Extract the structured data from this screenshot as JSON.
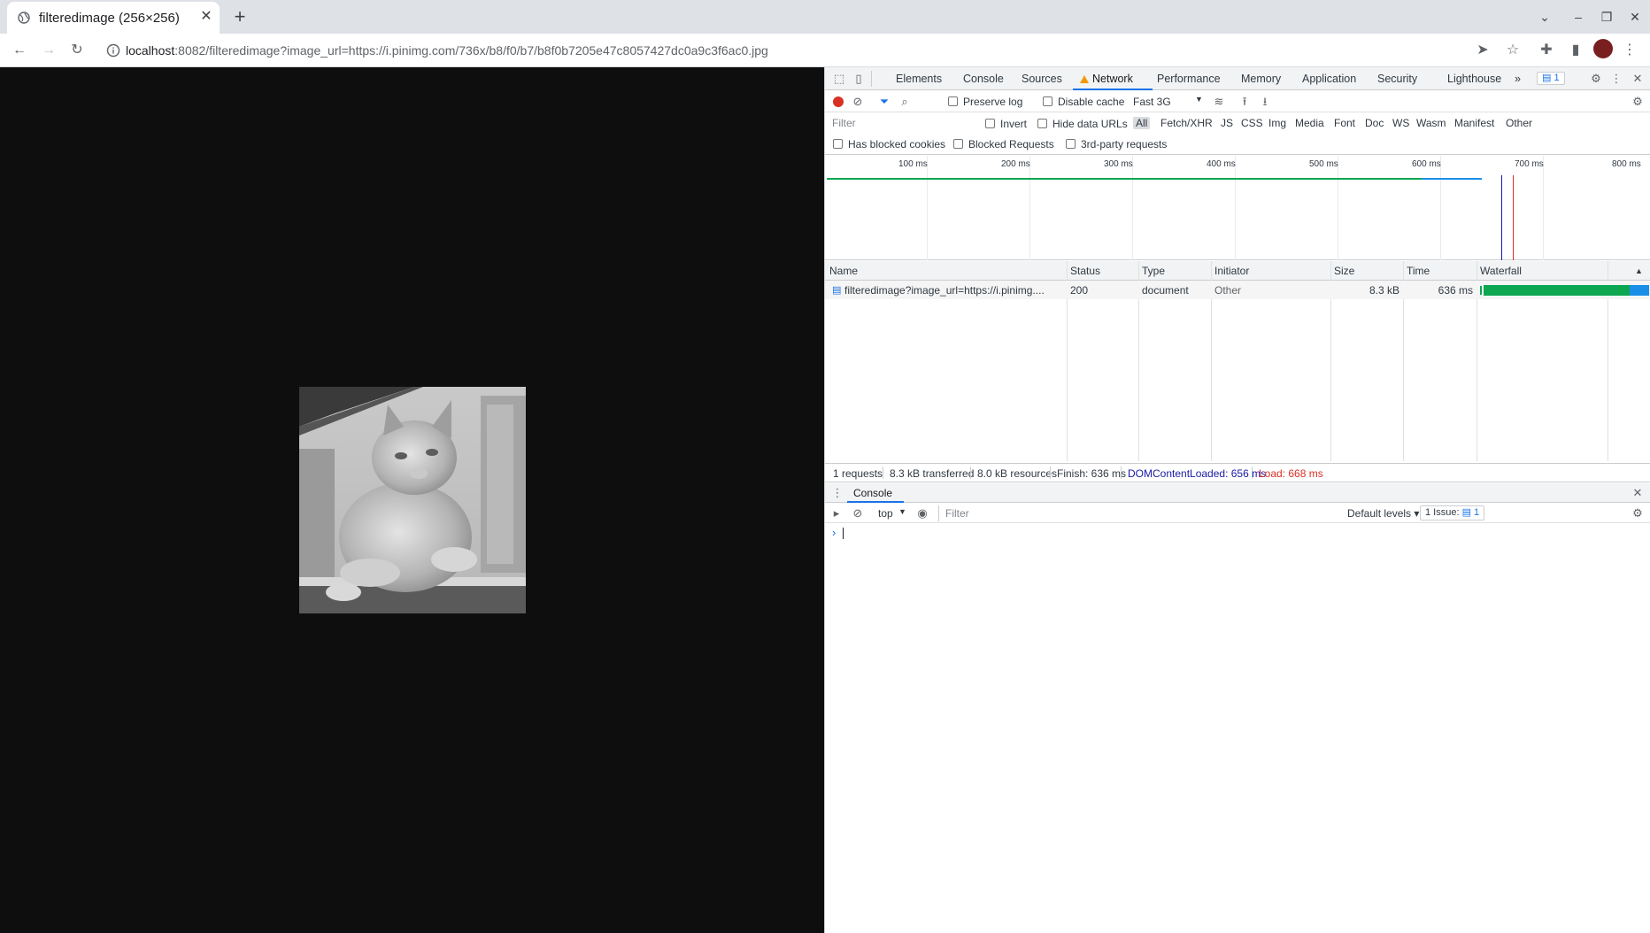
{
  "browser": {
    "tab": {
      "title": "filteredimage (256×256)",
      "close_label": "✕"
    },
    "new_tab_label": "+",
    "url": {
      "host": "localhost",
      "rest": ":8082/filteredimage?image_url=https://i.pinimg.com/736x/b8/f0/b7/b8f0b7205e47c8057427dc0a9c3f6ac0.jpg"
    }
  },
  "devtools": {
    "tabs": [
      "Elements",
      "Console",
      "Sources",
      "Network",
      "Performance",
      "Memory",
      "Application",
      "Security",
      "Lighthouse"
    ],
    "active_tab": "Network",
    "more_tabs": "»",
    "issues_badge": "1",
    "toolbar": {
      "preserve_log": "Preserve log",
      "disable_cache": "Disable cache",
      "throttling": "Fast 3G"
    },
    "filter": {
      "placeholder": "Filter",
      "invert": "Invert",
      "hide_data_urls": "Hide data URLs",
      "types": [
        "All",
        "Fetch/XHR",
        "JS",
        "CSS",
        "Img",
        "Media",
        "Font",
        "Doc",
        "WS",
        "Wasm",
        "Manifest",
        "Other"
      ],
      "has_blocked_cookies": "Has blocked cookies",
      "blocked_requests": "Blocked Requests",
      "third_party": "3rd-party requests"
    },
    "overview_ticks": [
      "100 ms",
      "200 ms",
      "300 ms",
      "400 ms",
      "500 ms",
      "600 ms",
      "700 ms",
      "800 ms"
    ],
    "table": {
      "columns": [
        "Name",
        "Status",
        "Type",
        "Initiator",
        "Size",
        "Time",
        "Waterfall"
      ],
      "rows": [
        {
          "name": "filteredimage?image_url=https://i.pinimg....",
          "status": "200",
          "type": "document",
          "initiator": "Other",
          "size": "8.3 kB",
          "time": "636 ms"
        }
      ]
    },
    "summary": {
      "requests": "1 requests",
      "transferred": "8.3 kB transferred",
      "resources": "8.0 kB resources",
      "finish": "Finish: 636 ms",
      "dcl": "DOMContentLoaded: 656 ms",
      "load": "Load: 668 ms"
    },
    "drawer": {
      "tab": "Console",
      "context": "top",
      "filter_placeholder": "Filter",
      "levels": "Default levels ▾",
      "issues": "1 Issue:",
      "issues_count": "1",
      "prompt": "›"
    }
  },
  "colors": {
    "page_bg": "#0e0e0e",
    "accent": "#1a73e8",
    "record": "#d93025",
    "waterfall_green": "#0ea751",
    "waterfall_blue": "#1a8fe8",
    "dcl_line": "#1a1aa6",
    "load_line": "#d93025"
  }
}
